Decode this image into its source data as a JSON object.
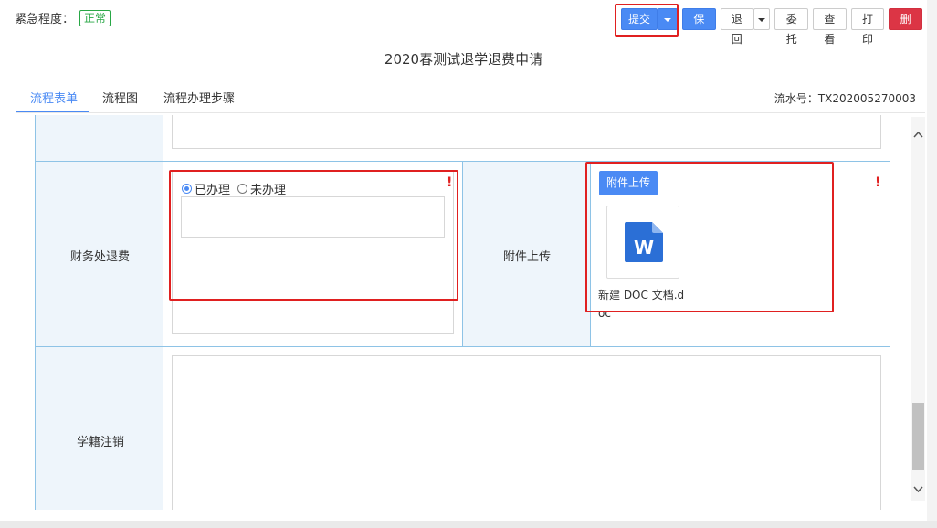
{
  "header": {
    "urgency_label": "紧急程度：",
    "urgency_value": "正常"
  },
  "toolbar": {
    "submit": "提交",
    "save": "保存",
    "return": "退回",
    "delegate": "委托",
    "view": "查看",
    "print": "打印",
    "delete": "删除"
  },
  "title": "2020春测试退学退费申请",
  "tabs": [
    {
      "label": "流程表单"
    },
    {
      "label": "流程图"
    },
    {
      "label": "流程办理步骤"
    }
  ],
  "serial_label": "流水号：TX202005270003",
  "form": {
    "finance_label": "财务处退费",
    "status_options": [
      "已办理",
      "未办理"
    ],
    "status_selected": "已办理",
    "attachment_label": "附件上传",
    "upload_button": "附件上传",
    "file_name": "新建 DOC 文档.doc",
    "required_mark": "!",
    "registry_label": "学籍注销"
  },
  "colors": {
    "primary": "#4a8af4",
    "danger": "#dc3545",
    "success": "#28a745",
    "highlight": "#e02020",
    "grid": "#8ec3e6"
  }
}
